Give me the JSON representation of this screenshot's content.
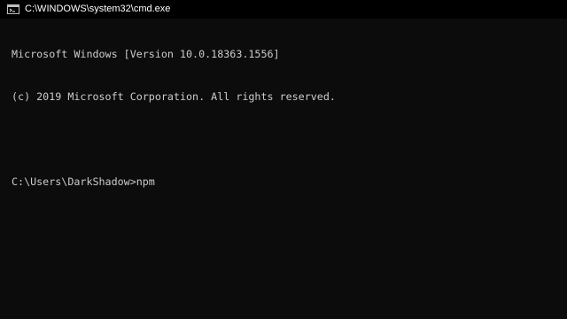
{
  "window": {
    "title": "C:\\WINDOWS\\system32\\cmd.exe",
    "icon": "cmd-icon"
  },
  "console": {
    "lines": [
      "Microsoft Windows [Version 10.0.18363.1556]",
      "(c) 2019 Microsoft Corporation. All rights reserved.",
      ""
    ],
    "prompt": "C:\\Users\\DarkShadow>",
    "input": "npm"
  },
  "colors": {
    "background": "#0c0c0c",
    "titlebar": "#000000",
    "text": "#cccccc",
    "title_text": "#ffffff"
  }
}
